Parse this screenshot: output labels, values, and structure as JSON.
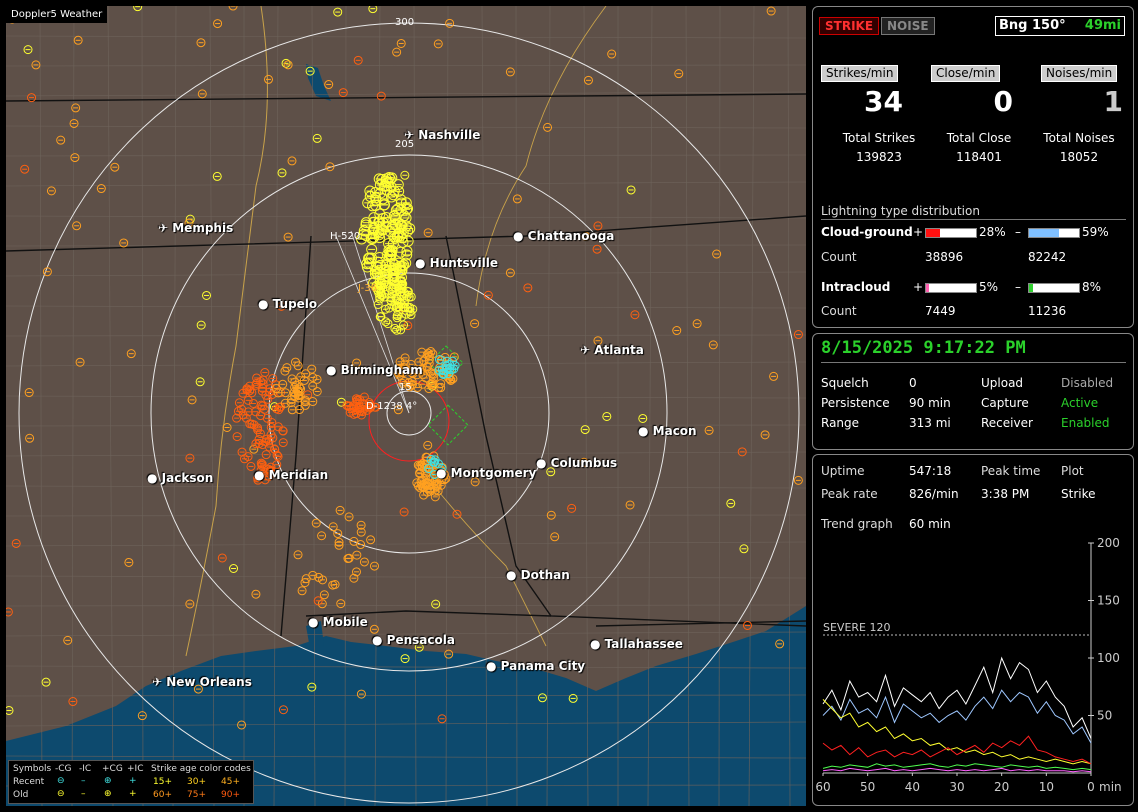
{
  "map": {
    "title": "Doppler5 Weather",
    "rings": [
      "300",
      "205",
      "15"
    ],
    "cities": [
      {
        "name": "Nashville",
        "airport": true
      },
      {
        "name": "Memphis",
        "airport": true
      },
      {
        "name": "Chattanooga",
        "airport": false
      },
      {
        "name": "Huntsville",
        "airport": false
      },
      {
        "name": "Tupelo",
        "airport": false
      },
      {
        "name": "Atlanta",
        "airport": true
      },
      {
        "name": "Birmingham",
        "airport": false
      },
      {
        "name": "Macon",
        "airport": false
      },
      {
        "name": "Jackson",
        "airport": false
      },
      {
        "name": "Meridian",
        "airport": false
      },
      {
        "name": "Montgomery",
        "airport": false
      },
      {
        "name": "Columbus",
        "airport": false
      },
      {
        "name": "Dothan",
        "airport": false
      },
      {
        "name": "Mobile",
        "airport": false
      },
      {
        "name": "Pensacola",
        "airport": false
      },
      {
        "name": "Tallahassee",
        "airport": false
      },
      {
        "name": "Panama City",
        "airport": false
      },
      {
        "name": "New Orleans",
        "airport": true
      }
    ],
    "cell_labels": [
      "H-520",
      "J-36",
      "D-1238 4°"
    ],
    "colors": {
      "land": "#5e5048",
      "water": "#0d4a6e",
      "recent": "#ffff30",
      "mid": "#ffa020",
      "old": "#ff6010",
      "ic": "#40e0e0"
    }
  },
  "legend": {
    "symbols_label": "Symbols",
    "types": [
      "-CG",
      "-IC",
      "+CG",
      "+IC"
    ],
    "age_label": "Strike age color codes",
    "recent_label": "Recent",
    "old_label": "Old",
    "recent_ages": [
      "15+",
      "30+",
      "45+"
    ],
    "old_ages": [
      "60+",
      "75+",
      "90+"
    ]
  },
  "header": {
    "strike_btn": "STRIKE",
    "noise_btn": "NOISE",
    "bearing": "Bng 150°",
    "distance": "49mi"
  },
  "rates": [
    {
      "label": "Strikes/min",
      "value": "34",
      "total_label": "Total Strikes",
      "total": "139823"
    },
    {
      "label": "Close/min",
      "value": "0",
      "total_label": "Total Close",
      "total": "118401"
    },
    {
      "label": "Noises/min",
      "value": "1",
      "total_label": "Total Noises",
      "total": "18052"
    }
  ],
  "distribution": {
    "title": "Lightning type distribution",
    "cg_label": "Cloud-ground",
    "ic_label": "Intracloud",
    "count_label": "Count",
    "plus": "+",
    "minus": "–",
    "cg_pos_pct": "28%",
    "cg_pos_frac": 0.28,
    "cg_pos_count": "38896",
    "cg_neg_pct": "59%",
    "cg_neg_frac": 0.59,
    "cg_neg_count": "82242",
    "ic_pos_pct": "5%",
    "ic_pos_frac": 0.05,
    "ic_pos_count": "7449",
    "ic_neg_pct": "8%",
    "ic_neg_frac": 0.08,
    "ic_neg_count": "11236"
  },
  "status": {
    "datetime": "8/15/2025 9:17:22 PM",
    "rows": [
      {
        "l1": "Squelch",
        "v1": "0",
        "l2": "Upload",
        "v2": "Disabled"
      },
      {
        "l1": "Persistence",
        "v1": "90 min",
        "l2": "Capture",
        "v2": "Active"
      },
      {
        "l1": "Range",
        "v1": "313 mi",
        "l2": "Receiver",
        "v2": "Enabled"
      }
    ]
  },
  "stats": {
    "uptime_label": "Uptime",
    "uptime": "547:18",
    "peak_time_label": "Peak time",
    "peak_time": "3:38 PM",
    "plot_label": "Plot",
    "plot": "Strike",
    "peak_rate_label": "Peak rate",
    "peak_rate": "826/min",
    "trend_label": "Trend graph",
    "trend": "60 min"
  },
  "chart_data": {
    "type": "line",
    "xlabel": "min",
    "xticks": [
      "60",
      "50",
      "40",
      "30",
      "20",
      "10",
      "0"
    ],
    "yticks": [
      "200",
      "150",
      "100",
      "50"
    ],
    "ylim": [
      0,
      200
    ],
    "threshold": {
      "label": "SEVERE 120",
      "value": 120
    },
    "series": [
      {
        "color": "#ffffff",
        "values": [
          60,
          72,
          55,
          80,
          66,
          70,
          62,
          85,
          58,
          74,
          68,
          62,
          70,
          56,
          66,
          72,
          60,
          76,
          92,
          70,
          100,
          82,
          96,
          90,
          70,
          80,
          66,
          58,
          40,
          48,
          30
        ]
      },
      {
        "color": "#9ec7ff",
        "values": [
          50,
          58,
          46,
          64,
          52,
          56,
          48,
          66,
          44,
          60,
          54,
          48,
          52,
          44,
          50,
          54,
          46,
          58,
          66,
          56,
          72,
          62,
          70,
          66,
          52,
          62,
          50,
          46,
          34,
          40,
          26
        ]
      },
      {
        "color": "#ffff30",
        "values": [
          64,
          56,
          48,
          52,
          40,
          44,
          36,
          40,
          30,
          34,
          28,
          30,
          24,
          26,
          20,
          22,
          18,
          20,
          16,
          18,
          14,
          16,
          12,
          14,
          12,
          10,
          12,
          10,
          8,
          10,
          8
        ]
      },
      {
        "color": "#ff2020",
        "values": [
          26,
          20,
          24,
          16,
          22,
          14,
          18,
          20,
          14,
          18,
          16,
          20,
          14,
          18,
          22,
          16,
          20,
          24,
          18,
          26,
          22,
          28,
          24,
          32,
          20,
          18,
          14,
          12,
          10,
          12,
          8
        ]
      },
      {
        "color": "#50ff50",
        "values": [
          4,
          6,
          5,
          7,
          6,
          5,
          8,
          6,
          7,
          5,
          6,
          7,
          8,
          6,
          5,
          7,
          6,
          8,
          7,
          6,
          5,
          7,
          6,
          5,
          6,
          4,
          5,
          4,
          3,
          4,
          3
        ]
      },
      {
        "color": "#ff60ff",
        "values": [
          2,
          3,
          2,
          4,
          3,
          2,
          3,
          4,
          2,
          3,
          2,
          3,
          4,
          3,
          2,
          3,
          2,
          3,
          2,
          3,
          4,
          2,
          3,
          2,
          3,
          2,
          2,
          2,
          1,
          2,
          1
        ]
      }
    ]
  }
}
